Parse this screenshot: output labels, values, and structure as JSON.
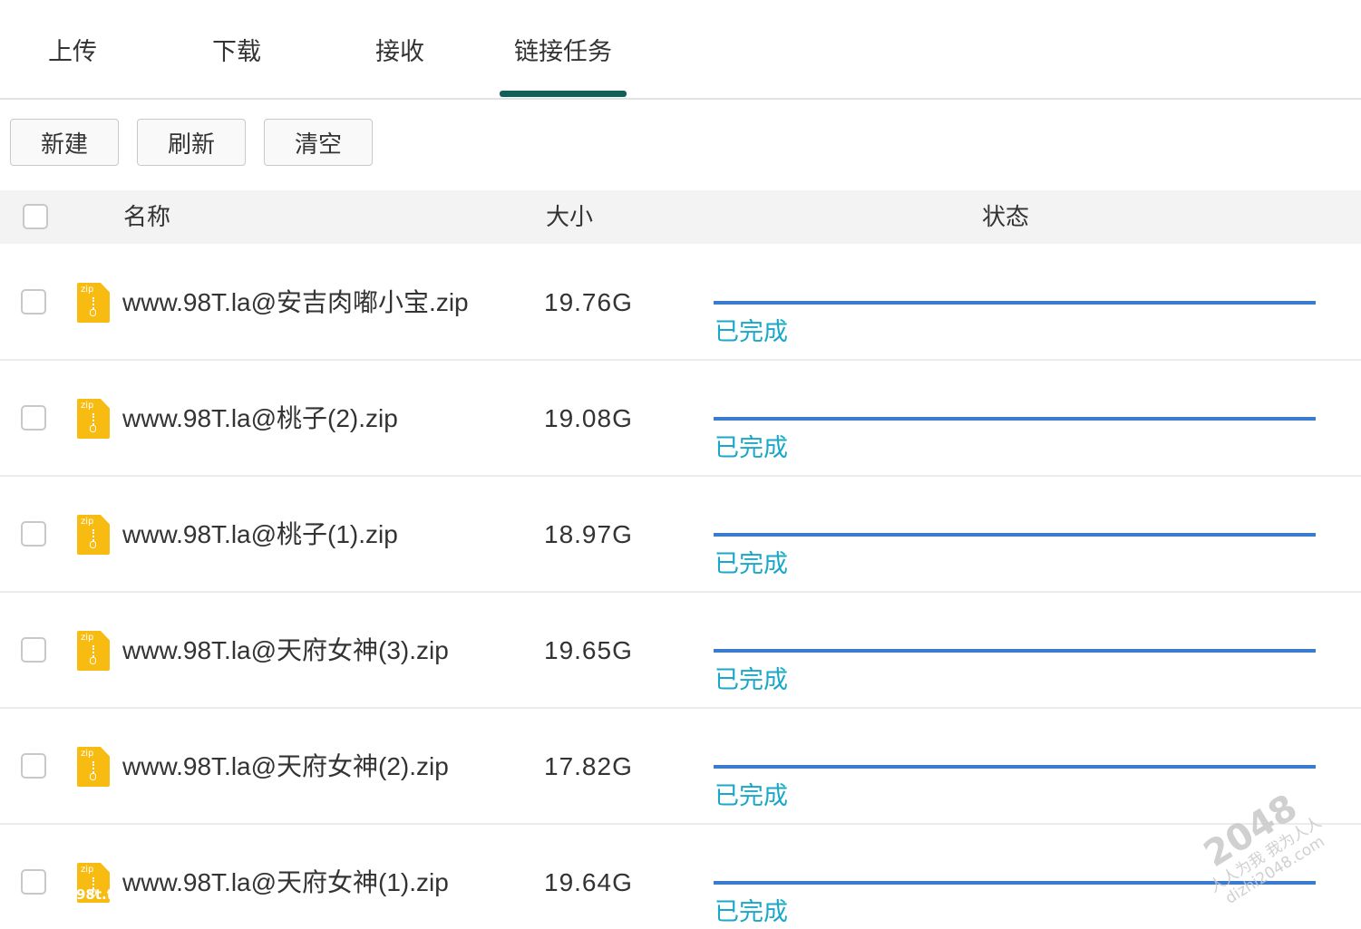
{
  "tabs": [
    {
      "label": "上传"
    },
    {
      "label": "下载"
    },
    {
      "label": "接收"
    },
    {
      "label": "链接任务",
      "active": true
    }
  ],
  "toolbar": {
    "new_label": "新建",
    "refresh_label": "刷新",
    "clear_label": "清空"
  },
  "table": {
    "headers": {
      "name": "名称",
      "size": "大小",
      "status": "状态"
    },
    "rows": [
      {
        "name": "www.98T.la@安吉肉嘟小宝.zip",
        "size": "19.76G",
        "status": "已完成",
        "progress": 1.0
      },
      {
        "name": "www.98T.la@桃子(2).zip",
        "size": "19.08G",
        "status": "已完成",
        "progress": 1.0
      },
      {
        "name": "www.98T.la@桃子(1).zip",
        "size": "18.97G",
        "status": "已完成",
        "progress": 1.0
      },
      {
        "name": "www.98T.la@天府女神(3).zip",
        "size": "19.65G",
        "status": "已完成",
        "progress": 1.0
      },
      {
        "name": "www.98T.la@天府女神(2).zip",
        "size": "17.82G",
        "status": "已完成",
        "progress": 1.0
      },
      {
        "name": "www.98T.la@天府女神(1).zip",
        "size": "19.64G",
        "status": "已完成",
        "progress": 1.0
      }
    ]
  },
  "file_icon_label": "zip",
  "watermarks": {
    "left": "98t.t",
    "right_big": "2048",
    "right_line1": "人人为我 我为人人",
    "right_line2": "dizhi2048.com"
  },
  "colors": {
    "tab_indicator": "#10605a",
    "progress_fill": "#3a7bd0",
    "status_text": "#19a8c8",
    "zip_icon": "#f7bb12"
  }
}
